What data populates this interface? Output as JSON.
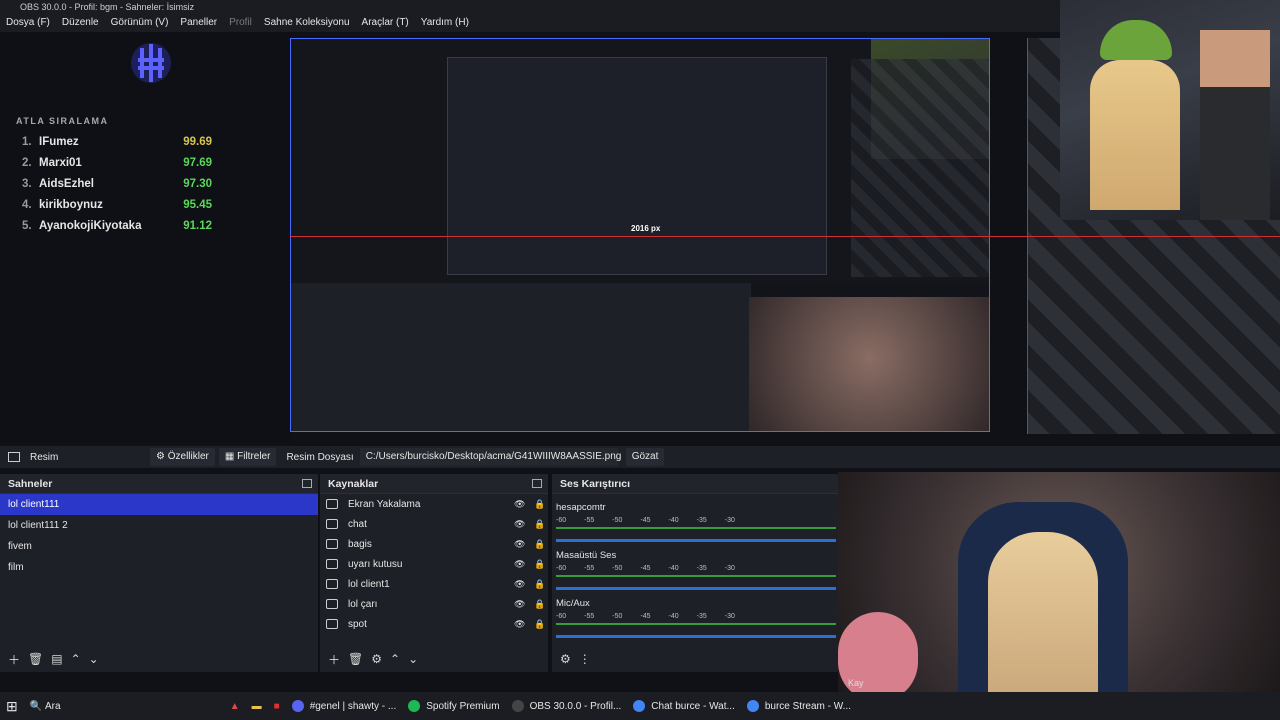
{
  "window": {
    "title": "OBS 30.0.0 - Profil: bgm - Sahneler: İsimsiz"
  },
  "menu": [
    {
      "label": "Dosya (F)"
    },
    {
      "label": "Düzenle"
    },
    {
      "label": "Görünüm (V)"
    },
    {
      "label": "Paneller"
    },
    {
      "label": "Profil",
      "disabled": true
    },
    {
      "label": "Sahne Koleksiyonu"
    },
    {
      "label": "Araçlar (T)"
    },
    {
      "label": "Yardım (H)"
    }
  ],
  "leaderboard": {
    "title": "ATLA SIRALAMA",
    "rows": [
      {
        "rank": "1.",
        "name": "IFumez",
        "score": "99.69",
        "color": "#d8c64a"
      },
      {
        "rank": "2.",
        "name": "Marxi01",
        "score": "97.69",
        "color": "#5ad85a"
      },
      {
        "rank": "3.",
        "name": "AidsEzhel",
        "score": "97.30",
        "color": "#5ad85a"
      },
      {
        "rank": "4.",
        "name": "kirikboynuz",
        "score": "95.45",
        "color": "#5ad85a"
      },
      {
        "rank": "5.",
        "name": "AyanokojiKiyotaka",
        "score": "91.12",
        "color": "#5ad85a"
      }
    ]
  },
  "preview": {
    "measure": "2016 px"
  },
  "properties": {
    "source_label": "Resim",
    "props_btn": "Özellikler",
    "filters_btn": "Filtreler",
    "file_label": "Resim Dosyası",
    "path": "C:/Users/burcisko/Desktop/acma/G41WIIIW8AASSIE.png",
    "browse": "Gözat"
  },
  "scenes": {
    "title": "Sahneler",
    "items": [
      "lol client111",
      "lol client111 2",
      "fivem",
      "film"
    ]
  },
  "sources": {
    "title": "Kaynaklar",
    "items": [
      {
        "label": "Ekran Yakalama",
        "icon": "monitor"
      },
      {
        "label": "chat",
        "icon": "globe"
      },
      {
        "label": "bagis",
        "icon": "globe"
      },
      {
        "label": "uyarı kutusu",
        "icon": "globe"
      },
      {
        "label": "lol client1",
        "icon": "monitor"
      },
      {
        "label": "lol çarı",
        "icon": "globe"
      },
      {
        "label": "spot",
        "icon": "globe"
      }
    ]
  },
  "mixer": {
    "title": "Ses Karıştırıcı",
    "scale": [
      "-60",
      "-55",
      "-50",
      "-45",
      "-40",
      "-35",
      "-30"
    ],
    "channels": [
      {
        "name": "hesapcomtr"
      },
      {
        "name": "Masaüstü Ses"
      },
      {
        "name": "Mic/Aux"
      }
    ]
  },
  "taskbar": {
    "search": "Ara",
    "items": [
      {
        "label": "#genel | shawty - ...",
        "color": "#5865f2"
      },
      {
        "label": "Spotify Premium",
        "color": "#1db954"
      },
      {
        "label": "OBS 30.0.0 - Profil...",
        "color": "#444"
      },
      {
        "label": "Chat burce - Wat...",
        "color": "#4285f4"
      },
      {
        "label": "burce Stream - W...",
        "color": "#4285f4"
      }
    ]
  },
  "webcam": {
    "overlay": "Kay"
  }
}
